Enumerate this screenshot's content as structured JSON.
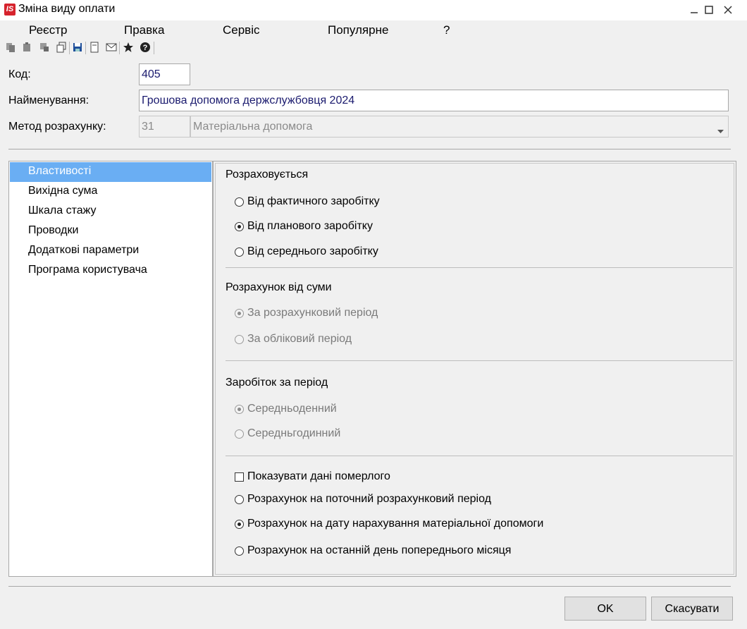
{
  "window": {
    "title": "Зміна виду оплати",
    "app_icon_text": "IS",
    "controls": [
      "minimize-icon",
      "maximize-icon",
      "close-icon"
    ]
  },
  "menu": [
    "Реєстр",
    "Правка",
    "Сервіс",
    "Популярне",
    "?"
  ],
  "toolbar": {
    "icons": [
      "copy-icon",
      "paste-icon",
      "cut-icon",
      "duplicate-icon",
      "save-icon",
      "document-icon",
      "mail-icon",
      "star-icon",
      "help-icon"
    ]
  },
  "form": {
    "code_label": "Код:",
    "code_value": "405",
    "name_label": "Найменування:",
    "name_value": "Грошова допомога держслужбовця 2024",
    "method_label": "Метод розрахунку:",
    "method_code": "31",
    "method_name": "Матеріальна допомога"
  },
  "nav": {
    "selected": "Властивості",
    "items": [
      "Властивості",
      "Вихідна сума",
      "Шкала стажу",
      "Проводки",
      "Додаткові параметри",
      "Програма користувача"
    ]
  },
  "panel": {
    "section1": {
      "title": "Розраховується",
      "options": [
        "Від фактичного заробітку",
        "Від планового заробітку",
        "Від середнього заробітку"
      ],
      "selected": "Від планового заробітку"
    },
    "section2": {
      "title": "Розрахунок від суми",
      "options": [
        "За розрахунковий період",
        "За обліковий період"
      ],
      "selected": "За розрахунковий період",
      "disabled": true
    },
    "section3": {
      "title": "Заробіток за період",
      "options": [
        "Середньоденний",
        "Середньгодинний"
      ],
      "selected": "Середньоденний",
      "disabled": true
    },
    "section4": {
      "checkbox_label": "Показувати дані померлого",
      "checkbox_checked": false,
      "options": [
        "Розрахунок на поточний розрахунковий період",
        "Розрахунок на дату нарахування матеріальної допомоги",
        "Розрахунок на останній день попереднього місяця"
      ],
      "selected": "Розрахунок на дату нарахування матеріальної допомоги"
    }
  },
  "buttons": {
    "ok": "OK",
    "cancel": "Скасувати"
  }
}
